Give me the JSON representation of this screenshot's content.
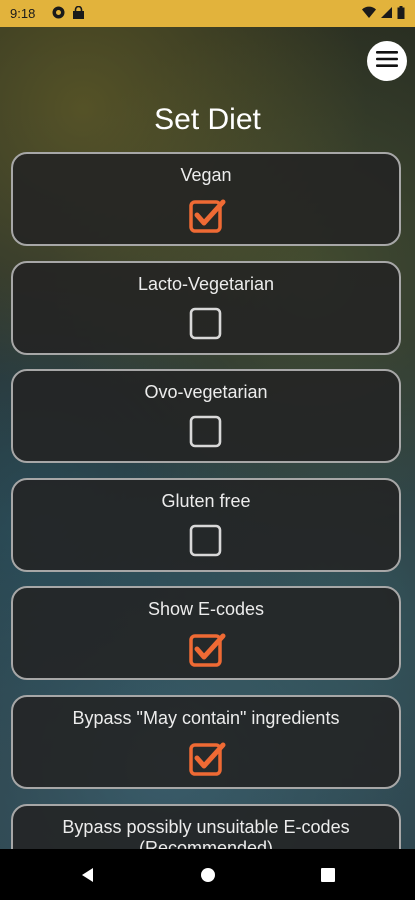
{
  "status_bar": {
    "time": "9:18"
  },
  "page": {
    "title": "Set Diet"
  },
  "colors": {
    "accent": "#ef6a34",
    "status_bar": "#e2b33c"
  },
  "options": [
    {
      "label": "Vegan",
      "checked": true
    },
    {
      "label": "Lacto-Vegetarian",
      "checked": false
    },
    {
      "label": "Ovo-vegetarian",
      "checked": false
    },
    {
      "label": "Gluten free",
      "checked": false
    },
    {
      "label": "Show E-codes",
      "checked": true
    },
    {
      "label": "Bypass \"May contain\" ingredients",
      "checked": true
    },
    {
      "label": "Bypass possibly unsuitable E-codes (Recommended)",
      "checked": false
    }
  ],
  "icons": {
    "menu": "hamburger-menu-icon",
    "back": "nav-back-icon",
    "home": "nav-home-icon",
    "recents": "nav-recents-icon"
  }
}
